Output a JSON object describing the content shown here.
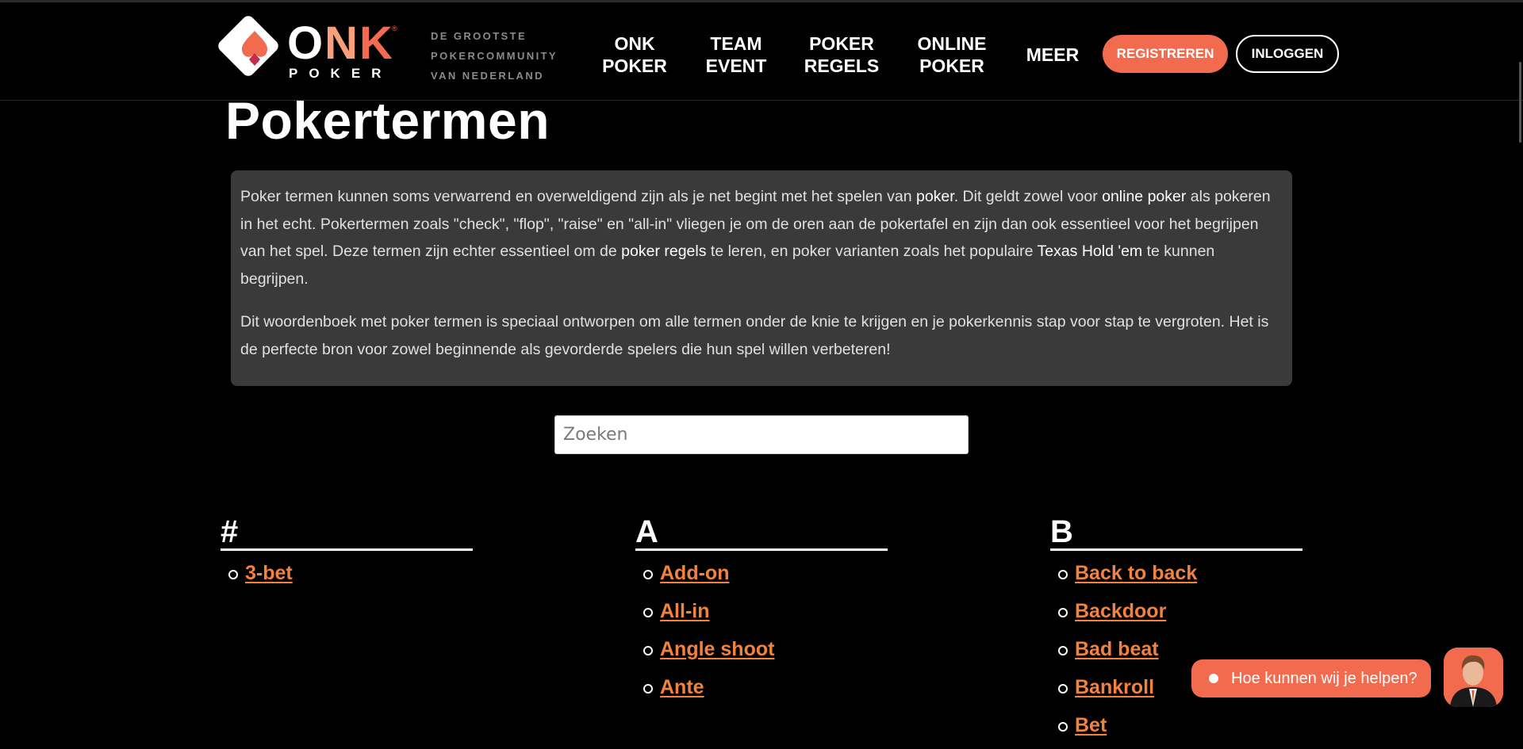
{
  "header": {
    "logo": {
      "brand": "ONK",
      "brand_letters": [
        "O",
        "N",
        "K"
      ],
      "sub": "POKER",
      "registered": "®"
    },
    "tagline": [
      "DE GROOTSTE",
      "POKERCOMMUNITY",
      "VAN NEDERLAND"
    ],
    "nav": [
      {
        "line1": "ONK",
        "line2": "POKER"
      },
      {
        "line1": "TEAM",
        "line2": "EVENT"
      },
      {
        "line1": "POKER",
        "line2": "REGELS"
      },
      {
        "line1": "ONLINE",
        "line2": "POKER"
      },
      {
        "line1": "MEER",
        "line2": ""
      }
    ],
    "register_label": "REGISTREREN",
    "login_label": "INLOGGEN"
  },
  "page": {
    "title": "Pokertermen",
    "intro": {
      "p1": {
        "t1": "Poker termen kunnen soms verwarrend en overweldigend zijn als je net begint met het spelen van ",
        "link1": "poker",
        "t2": ". Dit geldt zowel voor ",
        "link2": "online poker",
        "t3": " als pokeren in het echt. Pokertermen zoals \"check\", \"flop\", \"raise\" en \"all-in\" vliegen je om de oren aan de pokertafel en zijn dan ook essentieel voor het begrijpen van het spel. Deze termen zijn echter essentieel om de ",
        "link3": "poker regels",
        "t4": " te leren, en poker varianten zoals het populaire ",
        "link4": "Texas Hold 'em",
        "t5": " te kunnen begrijpen."
      },
      "p2": "Dit woordenboek met poker termen is speciaal ontworpen om alle termen onder de knie te krijgen en je pokerkennis stap voor stap te vergroten. Het is de perfecte bron voor zowel beginnende als gevorderde spelers die hun spel willen verbeteren!"
    },
    "search": {
      "placeholder": "Zoeken",
      "value": ""
    },
    "columns": [
      {
        "letter": "#",
        "terms": [
          "3-bet"
        ]
      },
      {
        "letter": "A",
        "terms": [
          "Add-on",
          "All-in",
          "Angle shoot",
          "Ante"
        ]
      },
      {
        "letter": "B",
        "terms": [
          "Back to back",
          "Backdoor",
          "Bad beat",
          "Bankroll",
          "Bet"
        ]
      }
    ]
  },
  "chat": {
    "label": "Hoe kunnen wij je helpen?"
  },
  "colors": {
    "accent": "#f26b4e",
    "link_orange": "#f2823c",
    "intro_bg": "#3a3a3a"
  }
}
